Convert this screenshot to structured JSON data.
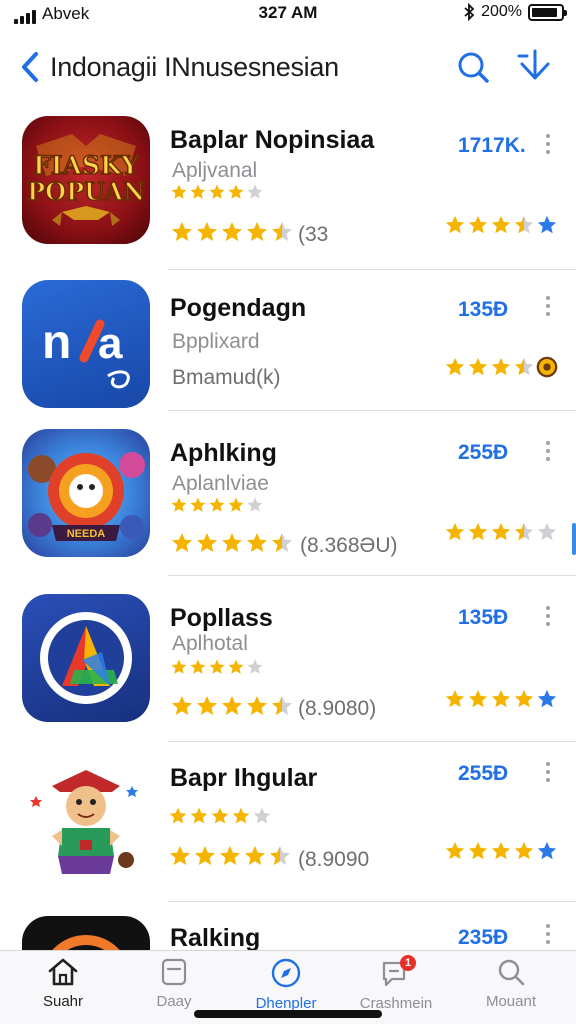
{
  "status_bar": {
    "carrier": "Abvek",
    "time": "327 AM",
    "battery_text": "200%",
    "battery_level": 0.9
  },
  "nav": {
    "title": "Indonagii INnusesnesian",
    "back_icon": "chevron-left-icon",
    "search_icon": "search-icon",
    "download_icon": "download-icon"
  },
  "colors": {
    "accent": "#1f6fe5",
    "star": "#f4b400",
    "separator": "#dcdce0"
  },
  "apps": [
    {
      "name": "Baplar Nopinsiaa",
      "subtitle": "Apljvanal",
      "rating_count": "(33",
      "price": "1717K.",
      "icon_text": [
        "FIASKY",
        "POPUAN"
      ],
      "small_rating": 4,
      "main_rating": 4.5,
      "side_rating": 3.5,
      "side_badge": "star"
    },
    {
      "name": "Pogendagn",
      "subtitle": "Bpplixard",
      "rating_count": "Bmamud(k)",
      "price": "135Ð",
      "icon_text": [
        "n",
        "a"
      ],
      "small_rating": 0,
      "main_rating": 0,
      "side_rating": 3.5,
      "side_badge": "coin"
    },
    {
      "name": "Aphlking",
      "subtitle": "Aplanlviae",
      "rating_count": "(8.368ƏU)",
      "price": "255Ð",
      "icon_text": [
        "NEEDA"
      ],
      "small_rating": 4,
      "main_rating": 4.5,
      "side_rating": 3.5,
      "side_badge": "none"
    },
    {
      "name": "Popllass",
      "subtitle": "Aplhotal",
      "rating_count": "(8.9080)",
      "price": "135Ð",
      "icon_text": [],
      "small_rating": 4,
      "main_rating": 4.5,
      "side_rating": 4,
      "side_badge": "star"
    },
    {
      "name": "Bapr Ihgular",
      "subtitle": "",
      "rating_count": "(8.9090",
      "price": "255Ð",
      "icon_text": [],
      "small_rating": 4,
      "main_rating": 4.5,
      "side_rating": 4,
      "side_badge": "star"
    },
    {
      "name": "Ralking",
      "subtitle": "",
      "rating_count": "",
      "price": "235Ð",
      "icon_text": [],
      "small_rating": 0,
      "main_rating": 0,
      "side_rating": 0,
      "side_badge": "none"
    }
  ],
  "tabs": [
    {
      "label": "Suahr",
      "icon": "home-icon",
      "state": "home"
    },
    {
      "label": "Daay",
      "icon": "today-icon",
      "state": "inactive"
    },
    {
      "label": "Dhenpler",
      "icon": "compass-icon",
      "state": "active"
    },
    {
      "label": "Crashmein",
      "icon": "chat-icon",
      "state": "inactive",
      "badge": "1"
    },
    {
      "label": "Mouant",
      "icon": "search-icon",
      "state": "inactive"
    }
  ]
}
